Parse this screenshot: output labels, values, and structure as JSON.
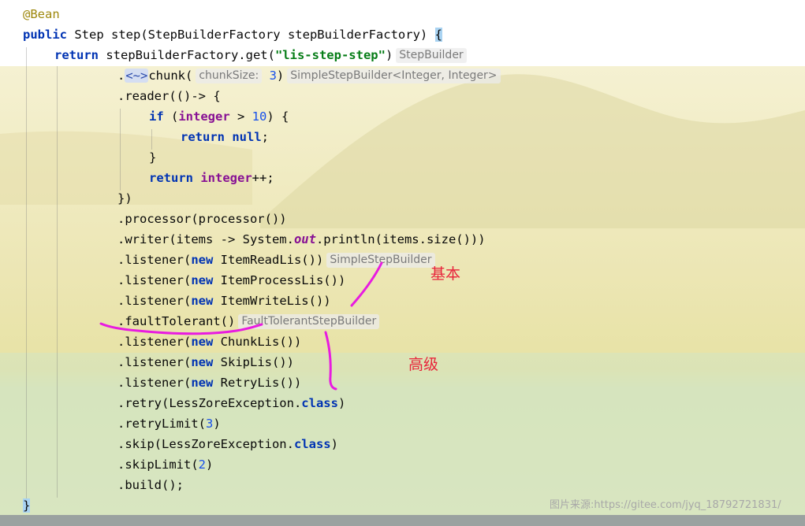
{
  "editor": {
    "lines": [
      "@Bean",
      "public Step step(StepBuilderFactory stepBuilderFactory) {",
      "return stepBuilderFactory.get(\"lis-step-step\")",
      ".<~>chunk( chunkSize: 3)",
      ".reader(()-> {",
      "if (integer > 10) {",
      "return null;",
      "}",
      "return integer++;",
      "})",
      ".processor(processor())",
      ".writer(items -> System.out.println(items.size()))",
      ".listener(new ItemReadLis())",
      ".listener(new ItemProcessLis())",
      ".listener(new ItemWriteLis())",
      ".faultTolerant()",
      ".listener(new ChunkLis())",
      ".listener(new SkipLis())",
      ".listener(new RetryLis())",
      ".retry(LessZoreException.class)",
      ".retryLimit(3)",
      ".skip(LessZoreException.class)",
      ".skipLimit(2)",
      ".build();",
      "}"
    ],
    "hints": {
      "step_builder": "StepBuilder",
      "chunk_size_label": "chunkSize:",
      "chunk_size_value": "3",
      "simple_step_builder_generic": "SimpleStepBuilder<Integer, Integer>",
      "simple_step_builder": "SimpleStepBuilder",
      "fault_tolerant_step_builder": "FaultTolerantStepBuilder"
    }
  },
  "annotations": {
    "basic": "基本",
    "advanced": "高级"
  },
  "watermark": "图片来源:https://gitee.com/jyq_18792721831/",
  "colors": {
    "keyword": "#0033b3",
    "string": "#067d17",
    "number": "#1750eb",
    "annotation": "#9e880d",
    "field": "#871094",
    "handwriting": "#e81be0",
    "label_red": "#e8243b"
  }
}
